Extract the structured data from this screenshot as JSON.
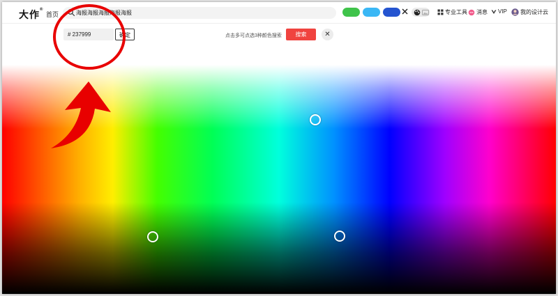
{
  "header": {
    "logo_text": "大作",
    "logo_mark": "®",
    "nav_home": "首页",
    "search_query": "海报海报海报海报海报",
    "swatch_colors": [
      "#3fc34a",
      "#3ab7f5",
      "#2454d0"
    ],
    "accent_color": "#f0433f",
    "menu": {
      "pro_tools": "专业工具",
      "messages": "消息",
      "vip": "VIP",
      "my_designs": "我的设计云"
    }
  },
  "color_picker": {
    "hex_value": "# 237999",
    "confirm_label": "确定",
    "hint_text": "点击多可点选3种颜色搜索",
    "search_label": "搜索",
    "close_symbol": "✕"
  },
  "toolbar_icons": [
    "search-icon",
    "close-icon",
    "palette-icon",
    "image-icon",
    "tool-icon",
    "message-icon",
    "vip-icon",
    "avatar"
  ]
}
